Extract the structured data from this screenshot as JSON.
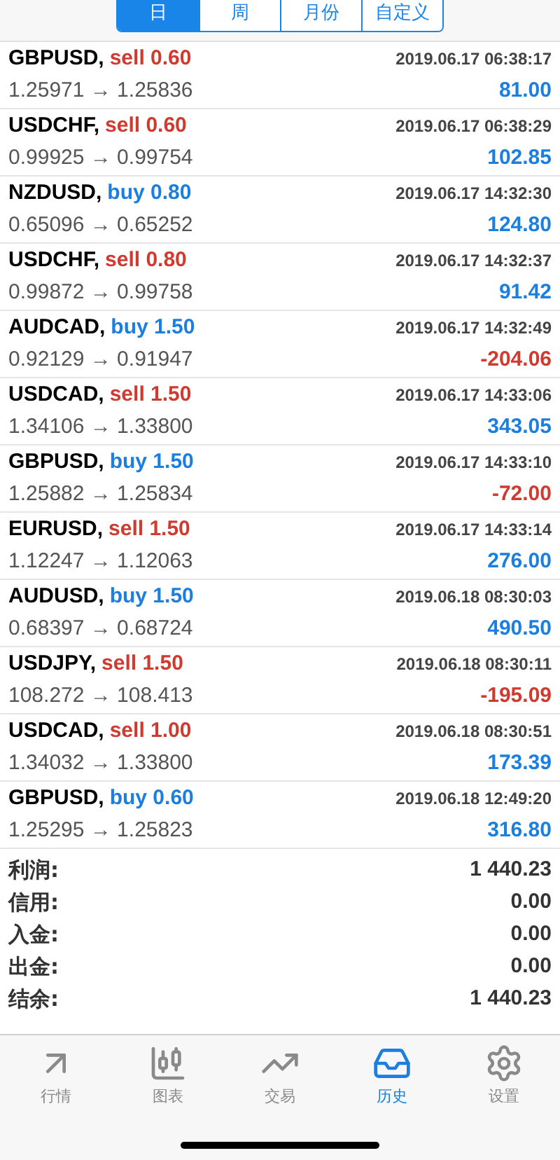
{
  "period_tabs": [
    {
      "label": "日",
      "selected": true
    },
    {
      "label": "周",
      "selected": false
    },
    {
      "label": "月份",
      "selected": false
    },
    {
      "label": "自定义",
      "selected": false
    }
  ],
  "deals": [
    {
      "symbol": "GBPUSD,",
      "kind": "sell",
      "volume": "sell 0.60",
      "time": "2019.06.17 06:38:17",
      "prices": "1.25971 → 1.25836",
      "profit": "81.00",
      "color": "#1a7fe0"
    },
    {
      "symbol": "USDCHF,",
      "kind": "sell",
      "volume": "sell 0.60",
      "time": "2019.06.17 06:38:29",
      "prices": "0.99925 → 0.99754",
      "profit": "102.85",
      "color": "#1a7fe0"
    },
    {
      "symbol": "NZDUSD,",
      "kind": "buy",
      "volume": "buy 0.80",
      "time": "2019.06.17 14:32:30",
      "prices": "0.65096 → 0.65252",
      "profit": "124.80",
      "color": "#1a7fe0"
    },
    {
      "symbol": "USDCHF,",
      "kind": "sell",
      "volume": "sell 0.80",
      "time": "2019.06.17 14:32:37",
      "prices": "0.99872 → 0.99758",
      "profit": "91.42",
      "color": "#1a7fe0"
    },
    {
      "symbol": "AUDCAD,",
      "kind": "buy",
      "volume": "buy 1.50",
      "time": "2019.06.17 14:32:49",
      "prices": "0.92129 → 0.91947",
      "profit": "-204.06",
      "color": "#d03a2f"
    },
    {
      "symbol": "USDCAD,",
      "kind": "sell",
      "volume": "sell 1.50",
      "time": "2019.06.17 14:33:06",
      "prices": "1.34106 → 1.33800",
      "profit": "343.05",
      "color": "#1a7fe0"
    },
    {
      "symbol": "GBPUSD,",
      "kind": "buy",
      "volume": "buy 1.50",
      "time": "2019.06.17 14:33:10",
      "prices": "1.25882 → 1.25834",
      "profit": "-72.00",
      "color": "#d03a2f"
    },
    {
      "symbol": "EURUSD,",
      "kind": "sell",
      "volume": "sell 1.50",
      "time": "2019.06.17 14:33:14",
      "prices": "1.12247 → 1.12063",
      "profit": "276.00",
      "color": "#1a7fe0"
    },
    {
      "symbol": "AUDUSD,",
      "kind": "buy",
      "volume": "buy 1.50",
      "time": "2019.06.18 08:30:03",
      "prices": "0.68397 → 0.68724",
      "profit": "490.50",
      "color": "#1a7fe0"
    },
    {
      "symbol": "USDJPY,",
      "kind": "sell",
      "volume": "sell 1.50",
      "time": "2019.06.18 08:30:11",
      "prices": "108.272 → 108.413",
      "profit": "-195.09",
      "color": "#d03a2f"
    },
    {
      "symbol": "USDCAD,",
      "kind": "sell",
      "volume": "sell 1.00",
      "time": "2019.06.18 08:30:51",
      "prices": "1.34032 → 1.33800",
      "profit": "173.39",
      "color": "#1a7fe0"
    },
    {
      "symbol": "GBPUSD,",
      "kind": "buy",
      "volume": "buy 0.60",
      "time": "2019.06.18 12:49:20",
      "prices": "1.25295 → 1.25823",
      "profit": "316.80",
      "color": "#1a7fe0"
    }
  ],
  "summary": [
    {
      "label": "利润:",
      "value": "1 440.23"
    },
    {
      "label": "信用:",
      "value": "0.00"
    },
    {
      "label": "入金:",
      "value": "0.00"
    },
    {
      "label": "出金:",
      "value": "0.00"
    },
    {
      "label": "结余:",
      "value": "1 440.23"
    }
  ],
  "tab_bar": [
    {
      "kind": "quotes",
      "label": "行情",
      "selected": false
    },
    {
      "kind": "chart",
      "label": "图表",
      "selected": false
    },
    {
      "kind": "trade",
      "label": "交易",
      "selected": false
    },
    {
      "kind": "history",
      "label": "历史",
      "selected": true
    },
    {
      "kind": "settings",
      "label": "设置",
      "selected": false
    }
  ]
}
